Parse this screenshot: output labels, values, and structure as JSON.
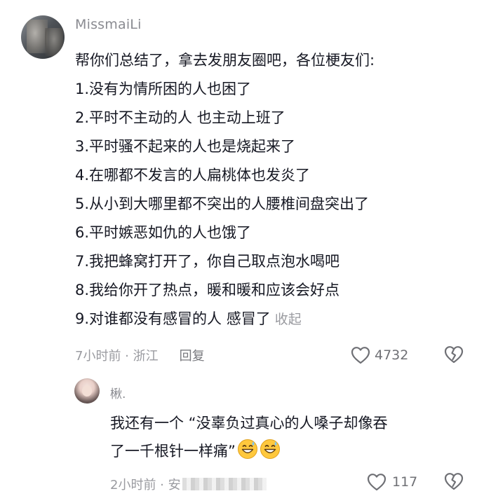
{
  "comment": {
    "username": "MissmaiLi",
    "lines": [
      "帮你们总结了，拿去发朋友圈吧，各位梗友们:",
      "1.没有为情所困的人也困了",
      "2.平时不主动的人 也主动上班了",
      "3.平时骚不起来的人也是烧起来了",
      "4.在哪都不发言的人扁桃体也发炎了",
      "5.从小到大哪里都不突出的人腰椎间盘突出了",
      "6.平时嫉恶如仇的人也饿了",
      "7.我把蜂窝打开了，你自己取点泡水喝吧",
      "8.我给你开了热点，暖和暖和应该会好点",
      "9.对谁都没有感冒的人 感冒了"
    ],
    "collapse_label": "收起",
    "time_location": "7小时前 · 浙江",
    "reply_label": "回复",
    "like_count": "4732"
  },
  "reply": {
    "username": "楸.",
    "lines": [
      "我还有一个 “没辜负过真心的人嗓子却像吞",
      "了一千根针一样痛”"
    ],
    "emojis": [
      "grin-sweat-emoji",
      "grin-sweat-emoji"
    ],
    "time_location": "2小时前 · 安",
    "like_count": "117"
  },
  "colors": {
    "text": "#161823",
    "secondary": "#9a9ba0",
    "username": "#8a8b91",
    "emoji_face": "#ffc83d"
  }
}
